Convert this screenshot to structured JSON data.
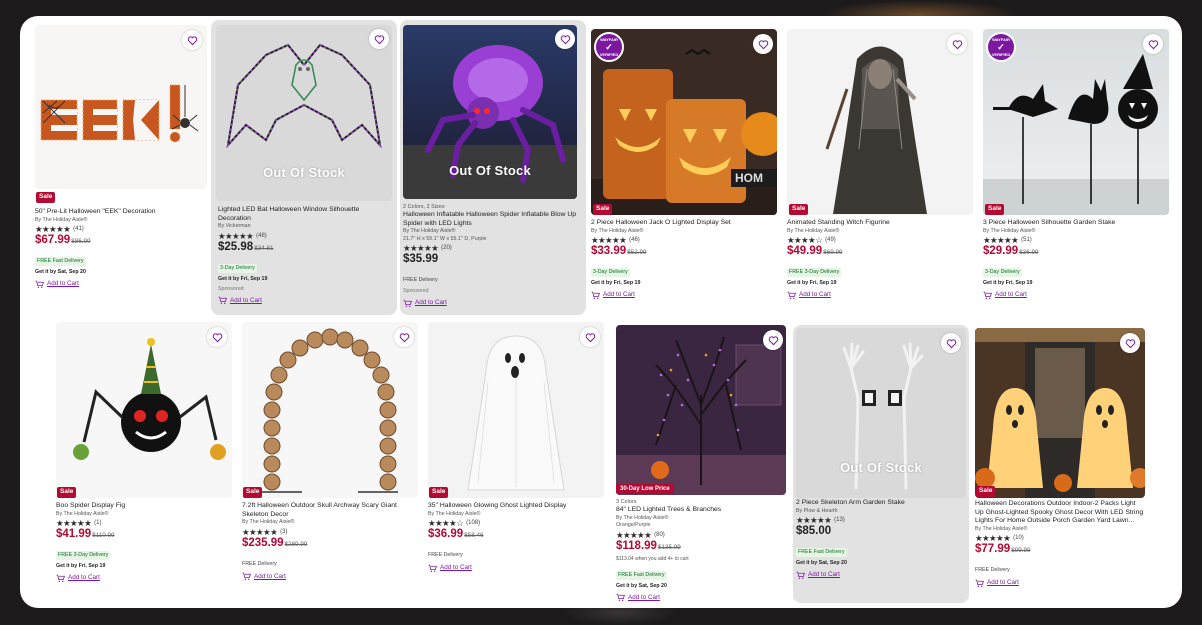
{
  "icons": {
    "favorite": "heart-outline-icon",
    "cart": "cart-plus-icon",
    "rating": "star-icon"
  },
  "colors": {
    "accent": "#7b189f",
    "sale": "#b30932",
    "shipping": "#0d6e2c"
  },
  "overlays": {
    "out_of_stock": "Out Of Stock",
    "verified_top": "WAYFAIR",
    "verified_bottom": "VERIFIED"
  },
  "products": [
    {
      "title": "50\" Pre-Lit Halloween \"EEK\" Decoration",
      "by": "By The Holiday Aisle®",
      "stars": "★★★★★",
      "reviews": "(41)",
      "rating": 4.5,
      "price": "$67.99",
      "was": "$86.99",
      "badge": "Sale",
      "shipping": "FREE Fast Delivery",
      "get": "Get it by Sat, Sep 20",
      "cart": "Add to Cart"
    },
    {
      "title": "Lighted LED Bat Halloween Window Silhouette Decoration",
      "by": "By Vickerman",
      "stars": "★★★★★",
      "reviews": "(48)",
      "rating": 4.5,
      "price": "$25.98",
      "was": "$34.81",
      "shipping": "3-Day Delivery",
      "get": "Get it by Fri, Sep 19",
      "sponsored": "Sponsored",
      "cart": "Add to Cart",
      "stock": "Out Of Stock"
    },
    {
      "options": "2 Colors, 2 Sizes",
      "title": "Halloween Inflatable Halloween Spider Inflatable Blow Up Spider with LED Lights",
      "by": "By The Holiday Aisle®",
      "dims": "21.7'' H x 59.1'' W x 55.1'' D, Purple",
      "stars": "★★★★★",
      "reviews": "(20)",
      "rating": 5,
      "price": "$35.99",
      "shipping": "FREE Delivery",
      "sponsored": "Sponsored",
      "cart": "Add to Cart",
      "stock": "Out Of Stock"
    },
    {
      "title": "2 Piece Halloween Jack O Lighted Display Set",
      "by": "By The Holiday Aisle®",
      "stars": "★★★★★",
      "reviews": "(46)",
      "rating": 5,
      "price": "$33.99",
      "was": "$52.99",
      "badge": "Sale",
      "shipping": "3-Day Delivery",
      "get": "Get it by Fri, Sep 19",
      "cart": "Add to Cart",
      "verified": true,
      "image_text": "HOM"
    },
    {
      "title": "Animated Standing Witch Figurine",
      "by": "By The Holiday Aisle®",
      "stars": "★★★★☆",
      "reviews": "(49)",
      "rating": 4,
      "price": "$49.99",
      "was": "$69.99",
      "badge": "Sale",
      "shipping": "FREE 3-Day Delivery",
      "get": "Get it by Fri, Sep 19",
      "cart": "Add to Cart"
    },
    {
      "title": "3 Piece Halloween Silhouette Garden Stake",
      "by": "By The Holiday Aisle®",
      "stars": "★★★★★",
      "reviews": "(51)",
      "rating": 4.5,
      "price": "$29.99",
      "was": "$36.99",
      "badge": "Sale",
      "shipping": "3-Day Delivery",
      "get": "Get it by Fri, Sep 19",
      "cart": "Add to Cart",
      "verified": true
    },
    {
      "title": "Boo Spider Display Fig",
      "by": "By The Holiday Aisle®",
      "stars": "★★★★★",
      "reviews": "(1)",
      "rating": 5,
      "price": "$41.99",
      "was": "$110.99",
      "badge": "Sale",
      "shipping": "FREE 3-Day Delivery",
      "get": "Get it by Fri, Sep 19",
      "cart": "Add to Cart"
    },
    {
      "title": "7.2ft Halloween Outdoor Skull Archway Scary Giant Skeleton Decor",
      "by": "By The Holiday Aisle®",
      "stars": "★★★★★",
      "reviews": "(3)",
      "rating": 5,
      "price": "$235.99",
      "was": "$289.99",
      "badge": "Sale",
      "shipping": "FREE Delivery",
      "cart": "Add to Cart"
    },
    {
      "title": "35\" Halloween Glowing Ghost Lighted Display",
      "by": "By The Holiday Aisle®",
      "stars": "★★★★☆",
      "reviews": "(108)",
      "rating": 4,
      "price": "$36.99",
      "was": "$58.46",
      "badge": "Sale",
      "shipping": "FREE Delivery",
      "cart": "Add to Cart"
    },
    {
      "options": "3 Colors",
      "title": "84\" LED Lighted Trees & Branches",
      "by": "By The Holiday Aisle®",
      "dims": "Orange/Purple",
      "stars": "★★★★★",
      "reviews": "(80)",
      "rating": 4.5,
      "price": "$118.99",
      "was": "$135.99",
      "badge": "30-Day Low Price",
      "note": "$113.04 when you add 4+ to cart",
      "shipping": "FREE Fast Delivery",
      "get": "Get it by Sat, Sep 20",
      "cart": "Add to Cart"
    },
    {
      "title": "2 Piece Skeleton Arm Garden Stake",
      "by": "By Plow & Hearth",
      "stars": "★★★★★",
      "reviews": "(13)",
      "rating": 4.5,
      "price": "$85.00",
      "shipping": "FREE Fast Delivery",
      "get": "Get it by Sat, Sep 20",
      "cart": "Add to Cart",
      "stock": "Out Of Stock"
    },
    {
      "title": "Halloween Decorations Outdoor Indoor-2 Packs Light Up Ghost-Lighted Spooky Ghost Decor With LED String Lights For Home Outside Porch Garden Yard Lawn...",
      "by": "By The Holiday Aisle®",
      "stars": "★★★★★",
      "reviews": "(10)",
      "rating": 5,
      "price": "$77.99",
      "was": "$99.99",
      "badge": "Sale",
      "shipping": "FREE Delivery",
      "cart": "Add to Cart"
    }
  ]
}
